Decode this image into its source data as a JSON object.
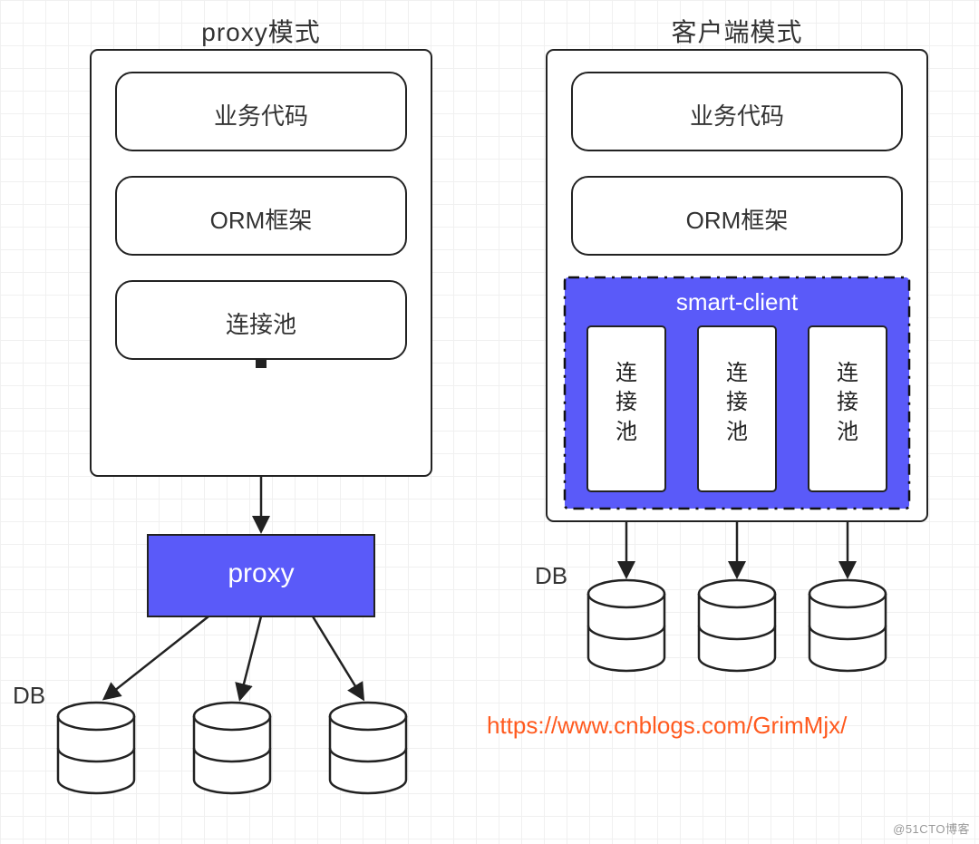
{
  "left": {
    "title": "proxy模式",
    "box1": "业务代码",
    "box2": "ORM框架",
    "box3": "连接池",
    "proxy": "proxy",
    "dbLabel": "DB"
  },
  "right": {
    "title": "客户端模式",
    "box1": "业务代码",
    "box2": "ORM框架",
    "smartClient": "smart-client",
    "pool1": "连\n接\n池",
    "pool2": "连\n接\n池",
    "pool3": "连\n接\n池",
    "dbLabel": "DB"
  },
  "url": "https://www.cnblogs.com/GrimMjx/",
  "watermark": "@51CTO博客",
  "colors": {
    "accent": "#5a5af9",
    "stroke": "#222222",
    "urlColor": "#ff5a1f"
  }
}
